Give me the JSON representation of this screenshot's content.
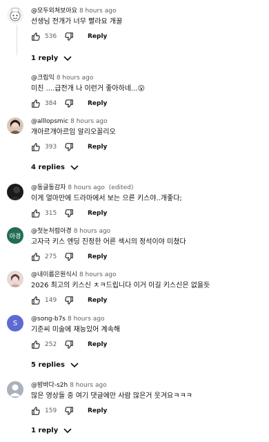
{
  "icons": {
    "like": "thumb-up-icon",
    "dislike": "thumb-down-icon",
    "chevron": "chevron-down-icon"
  },
  "reply_label": "Reply",
  "threads": [
    {
      "author": "@모두외쳐보아요",
      "time": "8 hours ago",
      "edited": "",
      "text": "선생님 전개가 너무 빨라요 개꿀",
      "likes": "536",
      "replies_label": "1 reply"
    },
    {
      "author": "@크림익",
      "time": "8 hours ago",
      "edited": "",
      "text": "미친 ....급전개 나 이런거 좋아하네...😮",
      "likes": "384",
      "replies_label": ""
    },
    {
      "author": "@alllopsmic",
      "time": "8 hours ago",
      "edited": "",
      "text": "개아르개아르임 알리오꼴리오",
      "likes": "393",
      "replies_label": "4 replies"
    },
    {
      "author": "@동글동감자",
      "time": "8 hours ago",
      "edited": "(edited)",
      "text": "이게 얼마만에 드라마에서 보는 으른 키스야..개좋다;",
      "likes": "315",
      "replies_label": ""
    },
    {
      "author": "@첫눈처럼아경",
      "time": "8 hours ago",
      "edited": "",
      "text": "고자극 키스 엔딩 진정한 어른 섹시의 정석이야 미쳤다",
      "likes": "275",
      "replies_label": ""
    },
    {
      "author": "@내이름은원식시",
      "time": "8 hours ago",
      "edited": "",
      "text": "2026 최고의 키스신 ㅊㅋ드립니다 이거 이길 키스신은 없을듯",
      "likes": "149",
      "replies_label": ""
    },
    {
      "author": "@song-b7s",
      "time": "8 hours ago",
      "edited": "",
      "text": "기준씨 미술에 재능있어 계속해",
      "likes": "252",
      "replies_label": "5 replies"
    },
    {
      "author": "@밤바다-s2h",
      "time": "8 hours ago",
      "edited": "",
      "text": "많은 영상들 중 여기 댓글에만 사람 많은거 웃겨요ㅋㅋㅋ",
      "likes": "159",
      "replies_label": "1 reply"
    }
  ],
  "avatars": {
    "green_initials": "아경",
    "letter_initial": "S"
  }
}
